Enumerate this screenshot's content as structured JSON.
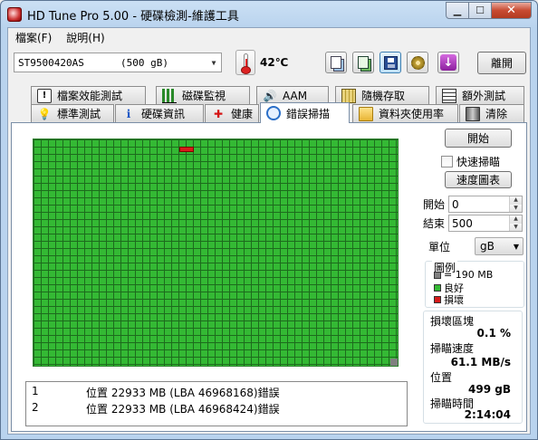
{
  "window": {
    "title": "HD Tune Pro  5.00 - 硬碟檢測-維護工具"
  },
  "menu": {
    "items": [
      "檔案(F)",
      "說明(H)"
    ]
  },
  "toolbar": {
    "drive_name": "ST9500420AS",
    "drive_size": "(500 gB)",
    "temperature": "42℃",
    "exit_label": "離開"
  },
  "tabs": {
    "row1": [
      "檔案效能測試",
      "磁碟監視",
      "AAM",
      "隨機存取",
      "額外測試"
    ],
    "row2": [
      "標準測試",
      "硬碟資訊",
      "健康",
      "錯誤掃描",
      "資料夾使用率",
      "清除"
    ],
    "selected": "錯誤掃描"
  },
  "scan": {
    "start_label": "開始",
    "quick_scan_label": "快速掃瞄",
    "quick_scan_checked": false,
    "speed_map_label": "速度圖表",
    "start_field_label": "開始",
    "start_value": "0",
    "end_field_label": "結束",
    "end_value": "500",
    "unit_label": "單位",
    "unit_value": "gB"
  },
  "legend": {
    "title": "圖例",
    "block_size": "= 190 MB",
    "good": "良好",
    "damaged": "損壞",
    "colors": {
      "block": "#808080",
      "good": "#34b934",
      "damaged": "#d61a1a"
    }
  },
  "stats": {
    "damaged_blocks_label": "損壞區塊",
    "damaged_blocks_value": "0.1 %",
    "scan_speed_label": "掃瞄速度",
    "scan_speed_value": "61.1 MB/s",
    "position_label": "位置",
    "position_value": "499 gB",
    "scan_time_label": "掃瞄時間",
    "scan_time_value": "2:14:04"
  },
  "errors": [
    {
      "index": "1",
      "text": "位置 22933 MB (LBA 46968168)錯誤"
    },
    {
      "index": "2",
      "text": "位置 22933 MB (LBA 46968424)錯誤"
    }
  ]
}
